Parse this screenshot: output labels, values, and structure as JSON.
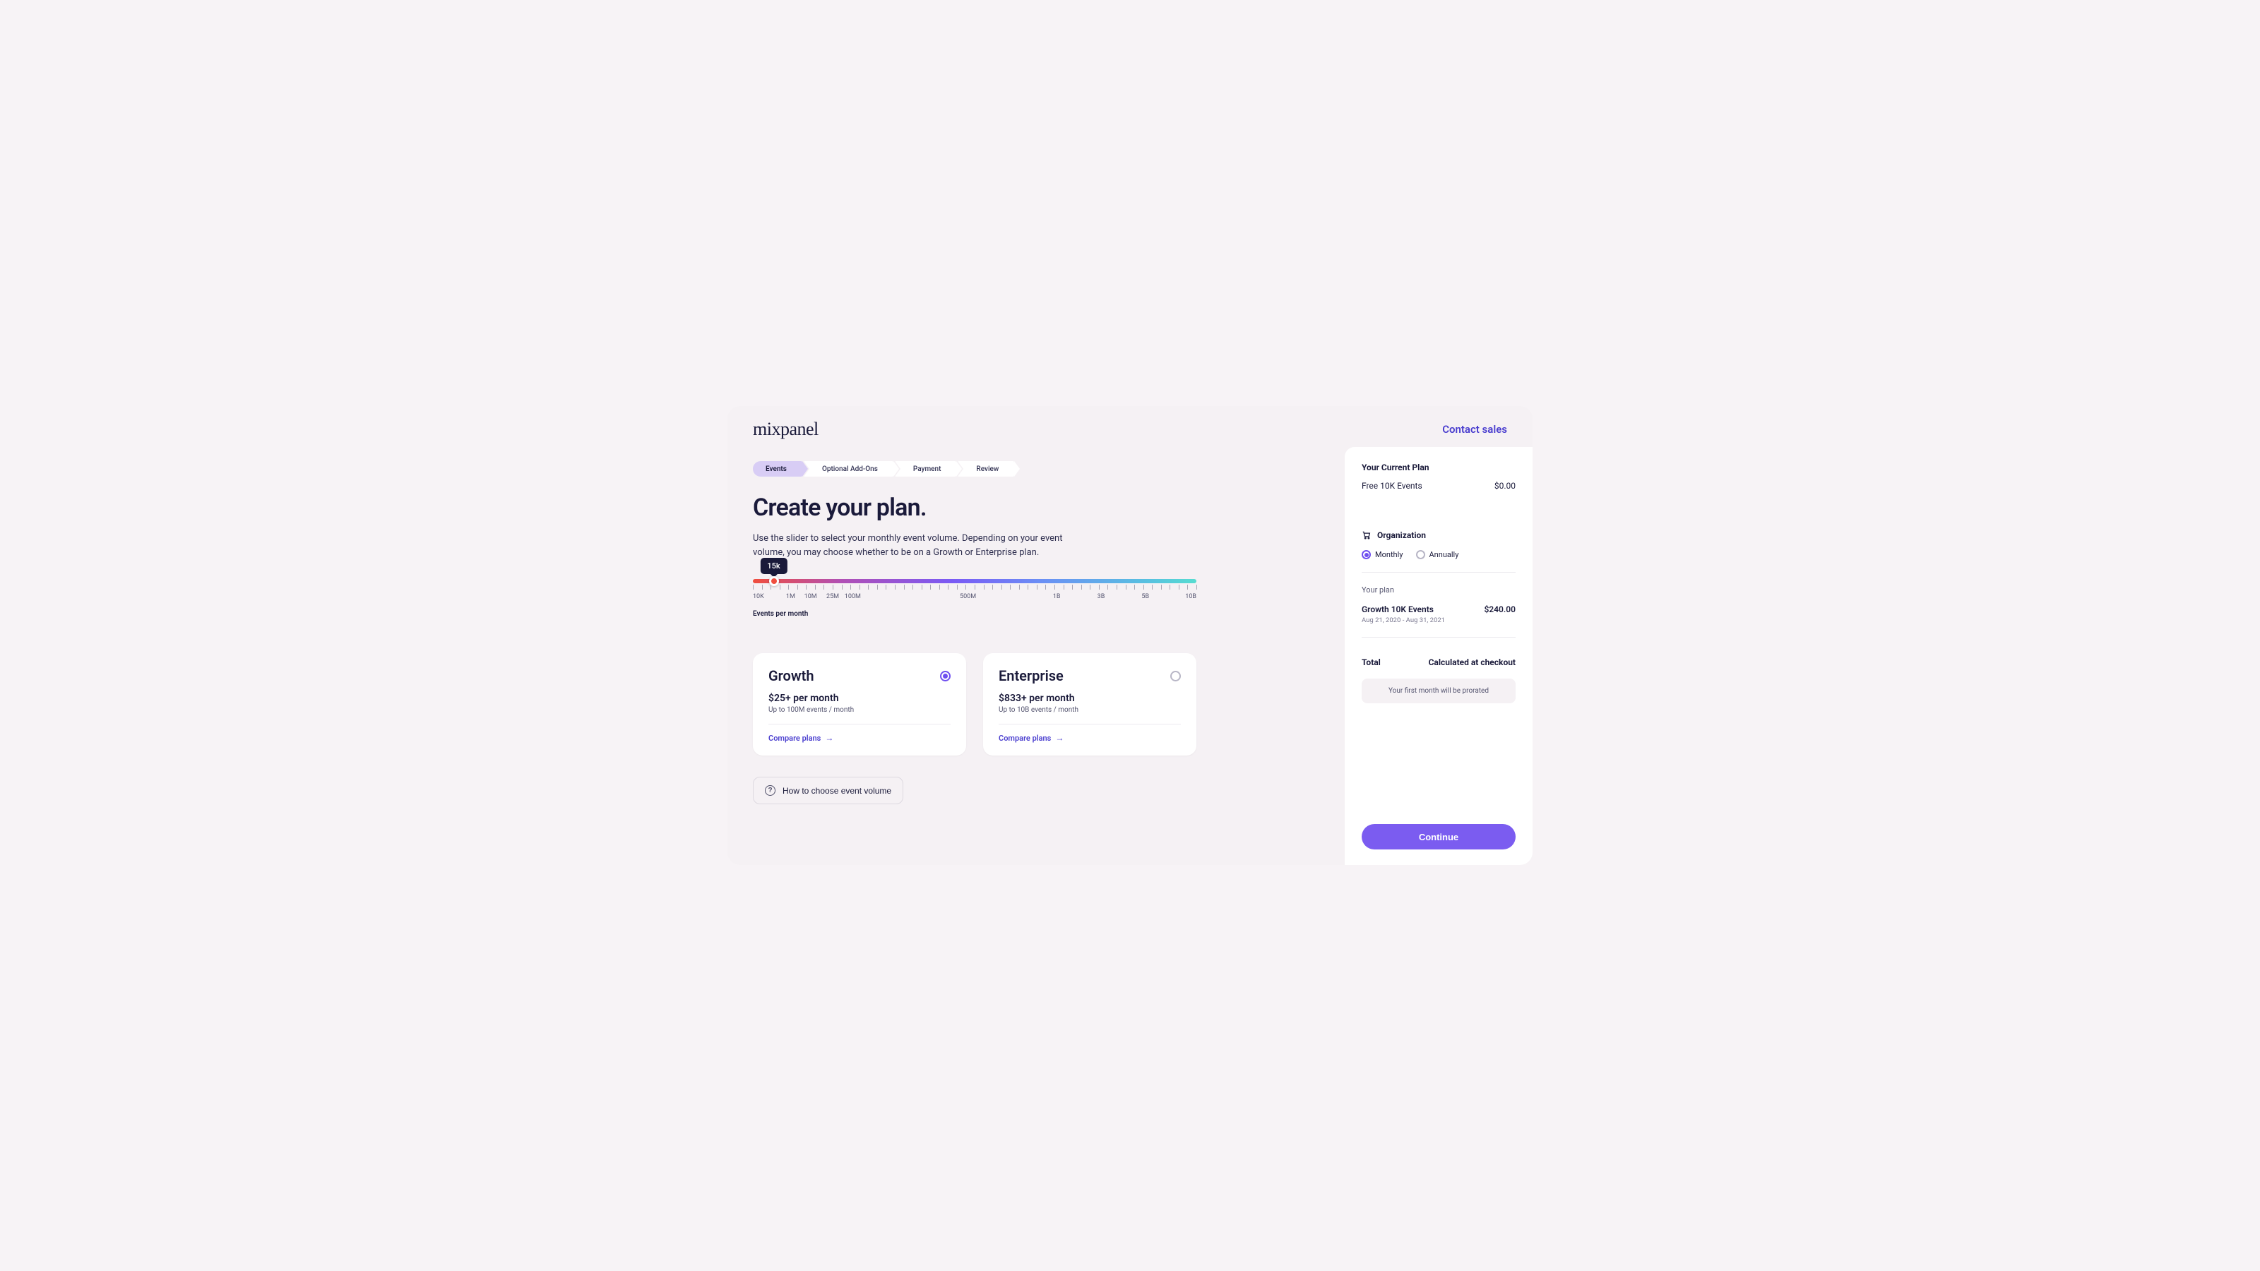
{
  "header": {
    "logo": "mixpanel",
    "contact": "Contact sales"
  },
  "stepper": {
    "steps": [
      "Events",
      "Optional Add-Ons",
      "Payment",
      "Review"
    ],
    "active_index": 0
  },
  "title": "Create your plan.",
  "subtitle": "Use the slider to select your monthly event volume. Depending on your event volume, you may choose whether to be on a Growth or Enterprise plan.",
  "slider": {
    "value_label": "15k",
    "ticks": [
      "10K",
      "1M",
      "10M",
      "25M",
      "100M",
      "500M",
      "1B",
      "3B",
      "5B",
      "10B"
    ],
    "tick_positions_pct": [
      0,
      8.5,
      13,
      18,
      22.5,
      48.5,
      68.5,
      78.5,
      88.5,
      100
    ],
    "caption": "Events per month"
  },
  "plans": {
    "growth": {
      "name": "Growth",
      "price": "$25+ per month",
      "sub": "Up to  100M events / month",
      "compare": "Compare plans",
      "selected": true
    },
    "enterprise": {
      "name": "Enterprise",
      "price": "$833+ per month",
      "sub": "Up to  10B events / month",
      "compare": "Compare plans",
      "selected": false
    }
  },
  "help_pill": "How to choose event volume",
  "sidebar": {
    "current_plan_label": "Your Current Plan",
    "current_plan_name": "Free 10K Events",
    "current_plan_amount": "$0.00",
    "org_label": "Organization",
    "billing_monthly": "Monthly",
    "billing_annually": "Annually",
    "plan_label": "Your plan",
    "plan_name": "Growth 10K Events",
    "plan_amount": "$240.00",
    "plan_dates": "Aug 21, 2020 - Aug 31, 2021",
    "total_label": "Total",
    "total_value": "Calculated at checkout",
    "prorate_note": "Your first month will be prorated",
    "continue": "Continue"
  }
}
